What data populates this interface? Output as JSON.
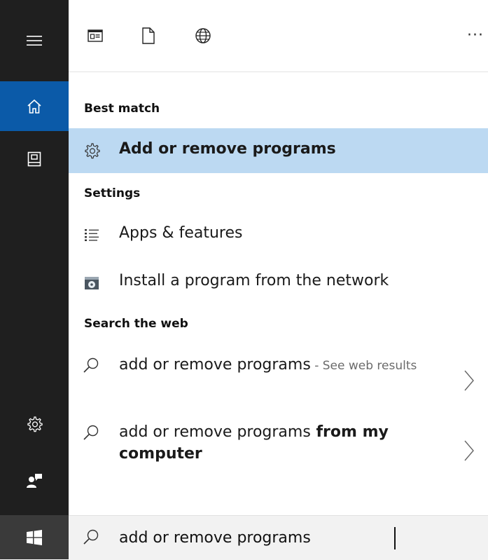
{
  "rail": {
    "items": [
      {
        "icon": "hamburger-menu-icon"
      },
      {
        "icon": "home-icon",
        "active": true
      },
      {
        "icon": "notebook-icon"
      },
      {
        "icon": "gear-icon"
      },
      {
        "icon": "user-feedback-icon"
      },
      {
        "icon": "windows-start-icon"
      }
    ],
    "active_color": "#0b5aa8",
    "background": "#1f1f1f"
  },
  "toolbar": {
    "icons": [
      "apps-filter-icon",
      "documents-filter-icon",
      "web-filter-icon"
    ],
    "more_label": "···"
  },
  "results": {
    "best_match": {
      "heading": "Best match",
      "item": {
        "label": "Add or remove programs",
        "icon": "gear-icon",
        "selected": true
      }
    },
    "settings": {
      "heading": "Settings",
      "items": [
        {
          "label": "Apps & features",
          "icon": "apps-list-icon"
        },
        {
          "label": "Install a program from the network",
          "icon": "install-program-icon"
        }
      ]
    },
    "web": {
      "heading": "Search the web",
      "items": [
        {
          "query": "add or remove programs",
          "suffix": " - See web results",
          "icon": "search-icon"
        },
        {
          "query": "add or remove programs",
          "bold_suffix": " from my computer",
          "icon": "search-icon"
        }
      ]
    },
    "selected_color": "#bcd9f2"
  },
  "search": {
    "value": "add or remove programs"
  }
}
